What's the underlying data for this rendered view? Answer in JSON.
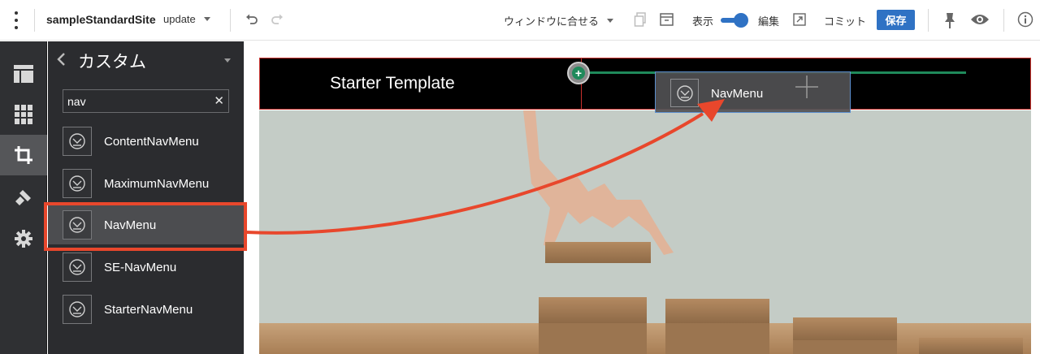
{
  "toolbar": {
    "site_name": "sampleStandardSite",
    "version_label": "update",
    "viewport_label": "ウィンドウに合せる",
    "show_label": "表示",
    "edit_label": "編集",
    "commit_label": "コミット",
    "save_label": "保存",
    "icons": [
      "more-vert-icon",
      "undo-icon",
      "redo-icon",
      "copy-icon",
      "layout-icon",
      "external-icon",
      "pin-icon",
      "eye-icon",
      "info-icon"
    ]
  },
  "rail": {
    "items": [
      "layout-icon",
      "components-icon",
      "crop-icon",
      "theme-brush-icon",
      "settings-gear-icon"
    ],
    "active": "crop-icon"
  },
  "panel": {
    "title": "カスタム",
    "search_value": "nav",
    "items": [
      {
        "label": "ContentNavMenu"
      },
      {
        "label": "MaximumNavMenu"
      },
      {
        "label": "NavMenu"
      },
      {
        "label": "SE-NavMenu"
      },
      {
        "label": "StarterNavMenu"
      }
    ],
    "selected": "NavMenu"
  },
  "canvas": {
    "header_title": "Starter Template",
    "drag_label": "NavMenu"
  },
  "colors": {
    "accent": "#2f72c4",
    "annotation": "#e8472c",
    "drop": "#1f8a5b"
  }
}
